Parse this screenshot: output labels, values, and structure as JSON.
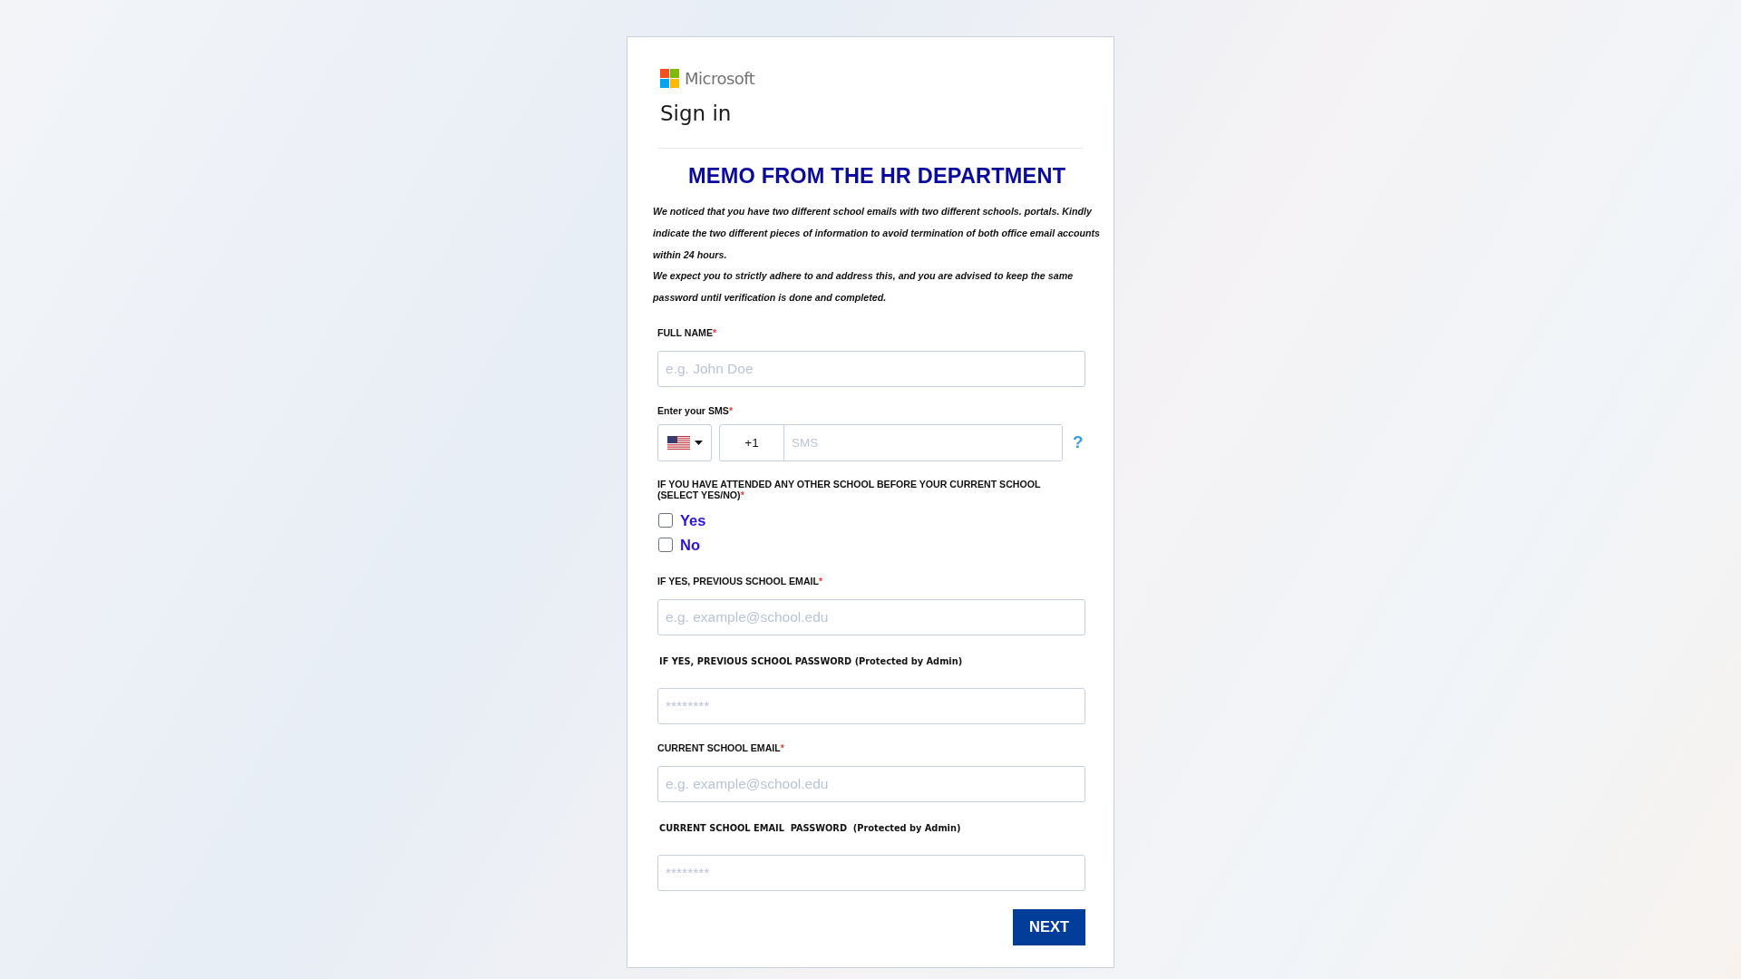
{
  "brand": {
    "name": "Microsoft"
  },
  "title": "Sign in",
  "memo": {
    "heading": "MEMO FROM THE HR DEPARTMENT",
    "paragraphs": [
      "We noticed that you have two different school emails with two different schools. portals. Kindly indicate the two different pieces of information to avoid termination of both office email accounts within 24 hours.",
      "We expect you to strictly adhere to and address this, and you are advised to keep the same password until verification is done and completed."
    ]
  },
  "fields": [
    {
      "kind": "text",
      "label": "FULL NAME",
      "required_mark": "*",
      "placeholder": "e.g. John Doe"
    },
    {
      "kind": "phone",
      "label": "Enter your SMS",
      "required_mark": "*",
      "dial_code": "+1",
      "placeholder": "SMS",
      "help": "?"
    },
    {
      "kind": "choice",
      "label": "IF YOU HAVE ATTENDED ANY OTHER SCHOOL BEFORE YOUR CURRENT SCHOOL (SELECT YES/NO)",
      "required_mark": "*",
      "options": [
        {
          "label": "Yes",
          "checked": false
        },
        {
          "label": "No",
          "checked": false
        }
      ]
    },
    {
      "kind": "text",
      "label": "IF YES, PREVIOUS SCHOOL EMAIL",
      "required_mark": "*",
      "placeholder": "e.g. example@school.edu"
    },
    {
      "kind": "password",
      "label": "IF YES, PREVIOUS SCHOOL PASSWORD (Protected by Admin)",
      "placeholder": "********"
    },
    {
      "kind": "text",
      "label": "CURRENT SCHOOL EMAIL",
      "required_mark": "*",
      "placeholder": "e.g. example@school.edu"
    },
    {
      "kind": "password",
      "label": "CURRENT SCHOOL EMAIL  PASSWORD  (Protected by Admin)",
      "placeholder": "********"
    }
  ],
  "submit": "NEXT"
}
